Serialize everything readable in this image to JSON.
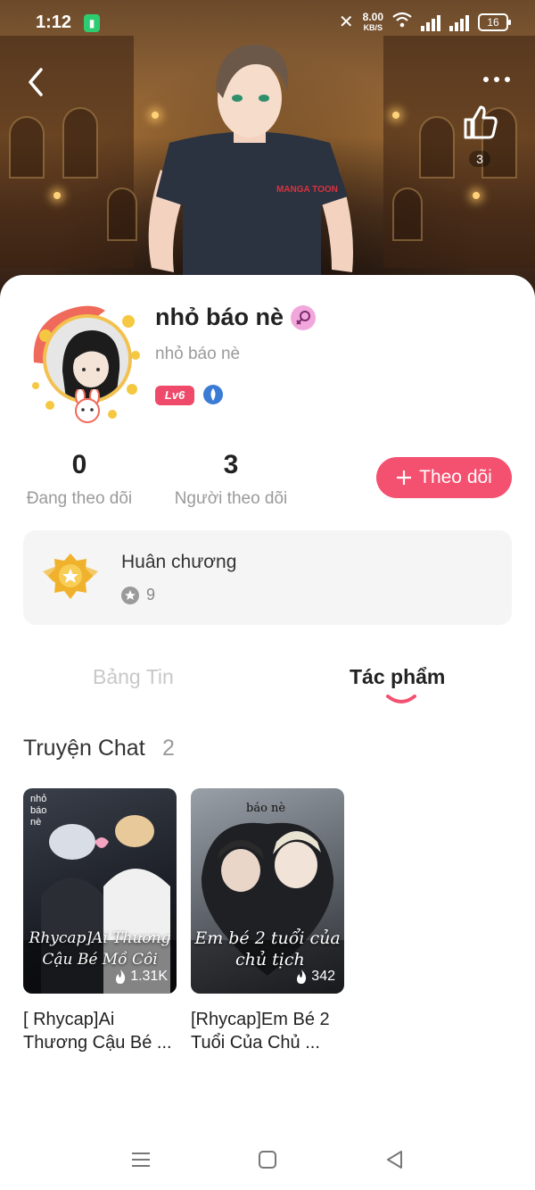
{
  "status_bar": {
    "time": "1:12",
    "battery_indicator": "▮",
    "net_speed_value": "8.00",
    "net_speed_unit": "KB/S",
    "battery_level": "16"
  },
  "banner": {
    "like_count": "3",
    "shirt_logo": "MANGA TOON"
  },
  "profile": {
    "name": "nhỏ báo nè",
    "handle": "nhỏ báo nè",
    "level": "Lv6"
  },
  "stats": {
    "following_count": "0",
    "following_label": "Đang theo dõi",
    "followers_count": "3",
    "followers_label": "Người theo dõi"
  },
  "follow_button": {
    "icon": "plus-icon",
    "label": "Theo dõi"
  },
  "medal": {
    "title": "Huân chương",
    "count": "9"
  },
  "tabs": [
    {
      "label": "Bảng Tin",
      "active": false
    },
    {
      "label": "Tác phẩm",
      "active": true
    }
  ],
  "section": {
    "title": "Truyện Chat",
    "count": "2"
  },
  "stories": [
    {
      "cover_tag": "nhỏ báo nè",
      "cover_line1": "Rhycap]Ai Thương",
      "cover_line2": "Cậu Bé Mồ Côi",
      "views": "1.31K",
      "title": "[ Rhycap]Ai Thương Cậu Bé ..."
    },
    {
      "cover_tag": "báo nè",
      "cover_line1": "Em bé 2 tuổi của",
      "cover_line2": "chủ tịch",
      "views": "342",
      "title": "[Rhycap]Em Bé 2 Tuổi Của Chủ ..."
    }
  ],
  "colors": {
    "accent": "#f4506f",
    "level_badge": "#ef4a6a",
    "muted_text": "#9a9a9a",
    "card_bg": "#f5f5f5"
  }
}
